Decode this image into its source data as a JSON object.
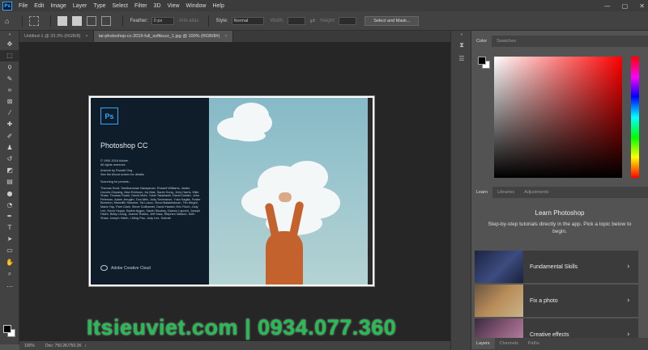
{
  "app": {
    "logo": "Ps"
  },
  "menu": [
    "File",
    "Edit",
    "Image",
    "Layer",
    "Type",
    "Select",
    "Filter",
    "3D",
    "View",
    "Window",
    "Help"
  ],
  "window_controls": {
    "minimize": "—",
    "maximize": "▢",
    "close": "✕"
  },
  "options": {
    "feather_label": "Feather:",
    "feather_value": "0 px",
    "antialias_label": "Anti-alias",
    "style_label": "Style:",
    "style_value": "Normal",
    "width_label": "Width:",
    "height_label": "Height:",
    "select_mask_label": "Select and Mask..."
  },
  "doc_tabs": [
    {
      "label": "Untitled-1 @ 33.3% (RGB/8)",
      "close": "×"
    },
    {
      "label": "tai-photoshop-cc-2019-full_softbuzz_1.jpg @ 100% (RGB/8#)",
      "close": "×"
    }
  ],
  "splash": {
    "logo": "Ps",
    "title": "Photoshop CC",
    "legal": "© 1990-2018 Adobe.\nAll rights reserved.",
    "credits_line": "Artwork by Ronald Ong\nSee the About screen for details",
    "status": "Scanning for presets...",
    "names": "Thomas Knoll, Seetharaman Narayanan, Russell Williams, Jackie Lincoln-Owyang, Alan Erickson, Ivy Mak, Sarah Kong, Jerry Harris, Mike Shaw, Thomas Ruark, David Mohr, Yukie Takahashi, David Dobish, John Peterson, Adam Jerugim, Tom Attix, Judy Severance, Yuko Kagita, Foster Brereton, Meredith Stotzner, Tai Luxon, Vinod Balakrishnan, Tim Wright, Maria Yap, Pam Clark, Steve Guilhamet, David Hackel, Eric Floch, Judy Lee, Kevin Hopps, Barkin Aygun, Sarah Stuckey, Damon Lapoint, Joseph Hsieh, Betty Leong, Jeanne Rubbo, Jeff Sass, Stephen Nielson, Seth Shaw, Joseph Hsieh, I-Ming Pao, Judy Lee, Sohrab",
    "footer": "Adobe Creative Cloud"
  },
  "status_bar": {
    "zoom": "100%",
    "doc": "Doc: 750.2K/750.2K"
  },
  "color_panel": {
    "tabs": [
      "Color",
      "Swatches"
    ]
  },
  "learn_panel": {
    "tabs": [
      "Learn",
      "Libraries",
      "Adjustments"
    ],
    "title": "Learn Photoshop",
    "description": "Step-by-step tutorials directly in the app. Pick a topic below to begin.",
    "cards": [
      {
        "label": "Fundamental Skills",
        "chevron": "›"
      },
      {
        "label": "Fix a photo",
        "chevron": "›"
      },
      {
        "label": "Creative effects",
        "chevron": "›"
      }
    ]
  },
  "bottom_tabs": [
    "Layers",
    "Channels",
    "Paths"
  ],
  "watermark": "Itsieuviet.com | 0934.077.360",
  "colors": {
    "accent": "#31a8ff",
    "watermark": "#20c050"
  }
}
